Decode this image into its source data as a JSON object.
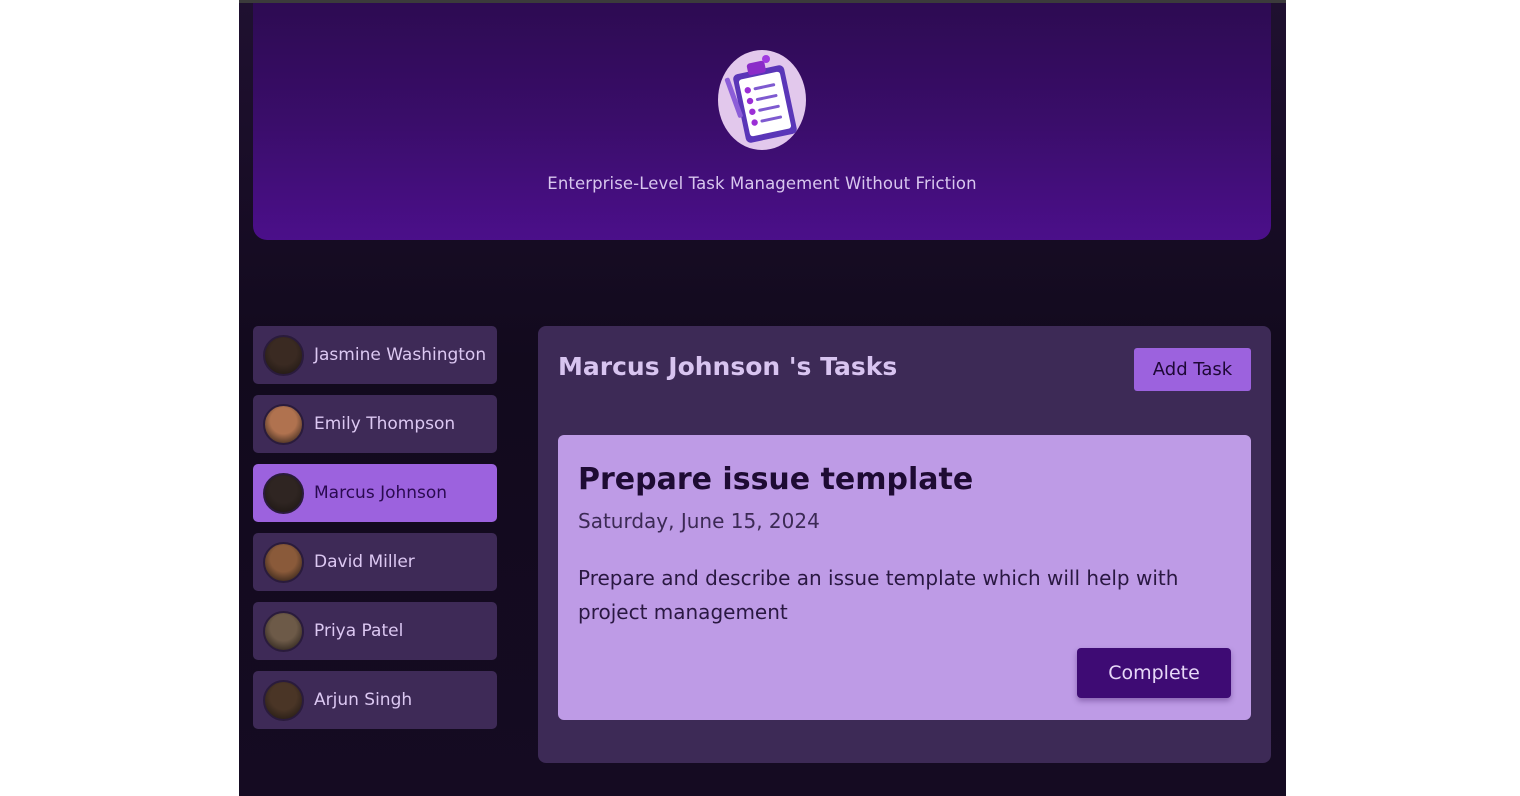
{
  "hero": {
    "tagline": "Enterprise-Level Task Management Without Friction",
    "logo_icon": "clipboard-checklist-icon"
  },
  "members": [
    {
      "name": "Jasmine Washington",
      "active": false,
      "avatar_color": "#3a2a22"
    },
    {
      "name": "Emily Thompson",
      "active": false,
      "avatar_color": "#b0724f"
    },
    {
      "name": "Marcus Johnson",
      "active": true,
      "avatar_color": "#2f2522"
    },
    {
      "name": "David Miller",
      "active": false,
      "avatar_color": "#8a5a3a"
    },
    {
      "name": "Priya Patel",
      "active": false,
      "avatar_color": "#6d5a48"
    },
    {
      "name": "Arjun Singh",
      "active": false,
      "avatar_color": "#4a3526"
    }
  ],
  "tasks_panel": {
    "title": "Marcus Johnson 's Tasks",
    "add_label": "Add Task"
  },
  "task": {
    "title": "Prepare issue template",
    "date": "Saturday, June 15, 2024",
    "description": "Prepare and describe an issue template which will help with project management",
    "complete_label": "Complete"
  },
  "colors": {
    "accent": "#9c62de",
    "card": "#be9be6",
    "button_dark": "#3e0b74"
  }
}
